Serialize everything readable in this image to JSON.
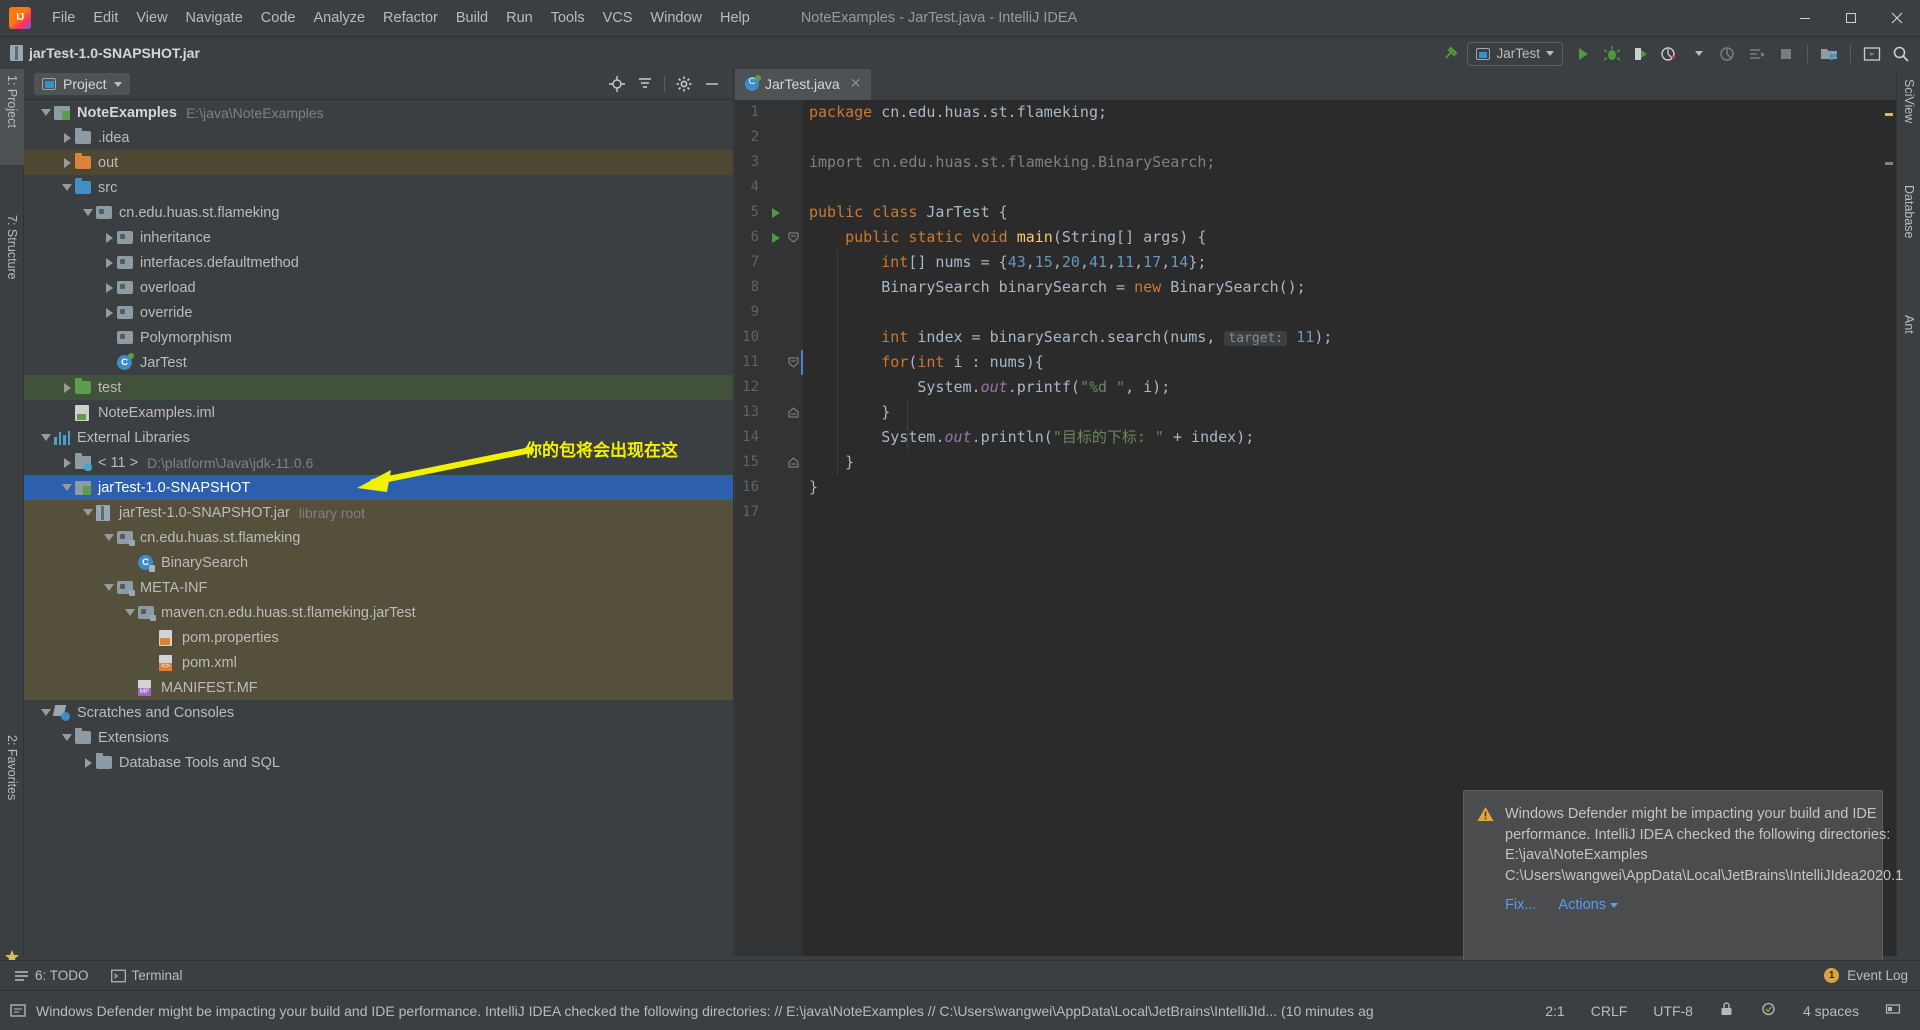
{
  "window": {
    "title": "NoteExamples - JarTest.java - IntelliJ IDEA",
    "logo_alt": "intellij-idea-logo",
    "minimize": "–",
    "maximize": "▢",
    "close": "✕"
  },
  "menu": {
    "items": [
      {
        "label": "File"
      },
      {
        "label": "Edit"
      },
      {
        "label": "View"
      },
      {
        "label": "Navigate"
      },
      {
        "label": "Code"
      },
      {
        "label": "Analyze"
      },
      {
        "label": "Refactor"
      },
      {
        "label": "Build"
      },
      {
        "label": "Run"
      },
      {
        "label": "Tools"
      },
      {
        "label": "VCS"
      },
      {
        "label": "Window"
      },
      {
        "label": "Help"
      }
    ]
  },
  "navbar": {
    "breadcrumb": "jarTest-1.0-SNAPSHOT.jar",
    "run_config": "JarTest",
    "icons": [
      "hammer-build-icon",
      "run-icon",
      "debug-icon",
      "run-coverage-icon",
      "profiler-icon",
      "attach-profiler-icon",
      "run-dashboard-icon",
      "stop-icon",
      "project-structure-icon",
      "updates-icon",
      "search-everywhere-icon"
    ]
  },
  "left_strip": {
    "tabs": [
      {
        "label": "1: Project",
        "active": true
      },
      {
        "label": "7: Structure",
        "active": false
      },
      {
        "label": "2: Favorites",
        "active": false
      }
    ]
  },
  "right_strip": {
    "tabs": [
      {
        "label": "SciView"
      },
      {
        "label": "Database"
      },
      {
        "label": "Ant"
      }
    ]
  },
  "project_panel": {
    "title": "Project",
    "actions": [
      "locate-icon",
      "collapse-all-icon",
      "settings-gear-icon",
      "hide-icon"
    ],
    "tree": [
      {
        "id": "noteexamples",
        "label": "NoteExamples",
        "sub": "E:\\java\\NoteExamples",
        "depth": 0,
        "twist": "down",
        "icon": "module-icon",
        "bold": true,
        "state": "normal"
      },
      {
        "id": "idea",
        "label": ".idea",
        "sub": "",
        "depth": 1,
        "twist": "right",
        "icon": "folder-icon",
        "bold": false,
        "state": "normal"
      },
      {
        "id": "out",
        "label": "out",
        "sub": "",
        "depth": 1,
        "twist": "right",
        "icon": "folder-orange-icon",
        "bold": false,
        "state": "out"
      },
      {
        "id": "src",
        "label": "src",
        "sub": "",
        "depth": 1,
        "twist": "down",
        "icon": "folder-blue-icon",
        "bold": false,
        "state": "normal"
      },
      {
        "id": "pkg-root",
        "label": "cn.edu.huas.st.flameking",
        "sub": "",
        "depth": 2,
        "twist": "down",
        "icon": "package-icon",
        "bold": false,
        "state": "normal"
      },
      {
        "id": "inheritance",
        "label": "inheritance",
        "sub": "",
        "depth": 3,
        "twist": "right",
        "icon": "package-icon",
        "bold": false,
        "state": "normal"
      },
      {
        "id": "interfaces",
        "label": "interfaces.defaultmethod",
        "sub": "",
        "depth": 3,
        "twist": "right",
        "icon": "package-icon",
        "bold": false,
        "state": "normal"
      },
      {
        "id": "overload",
        "label": "overload",
        "sub": "",
        "depth": 3,
        "twist": "right",
        "icon": "package-icon",
        "bold": false,
        "state": "normal"
      },
      {
        "id": "override",
        "label": "override",
        "sub": "",
        "depth": 3,
        "twist": "right",
        "icon": "package-icon",
        "bold": false,
        "state": "normal"
      },
      {
        "id": "polymorphism",
        "label": "Polymorphism",
        "sub": "",
        "depth": 3,
        "twist": "none",
        "icon": "package-icon",
        "bold": false,
        "state": "normal"
      },
      {
        "id": "jartest-class",
        "label": "JarTest",
        "sub": "",
        "depth": 3,
        "twist": "none",
        "icon": "java-class-runnable-icon",
        "bold": false,
        "state": "normal"
      },
      {
        "id": "test",
        "label": "test",
        "sub": "",
        "depth": 1,
        "twist": "right",
        "icon": "folder-green-icon",
        "bold": false,
        "state": "test"
      },
      {
        "id": "iml",
        "label": "NoteExamples.iml",
        "sub": "",
        "depth": 1,
        "twist": "none",
        "icon": "iml-file-icon",
        "bold": false,
        "state": "normal"
      },
      {
        "id": "extlibs",
        "label": "External Libraries",
        "sub": "",
        "depth": 0,
        "twist": "down",
        "icon": "external-libraries-icon",
        "bold": false,
        "state": "normal"
      },
      {
        "id": "jdk",
        "label": "< 11 >",
        "sub": "D:\\platform\\Java\\jdk-11.0.6",
        "depth": 1,
        "twist": "right",
        "icon": "jdk-icon",
        "bold": false,
        "state": "normal"
      },
      {
        "id": "jartest-lib",
        "label": "jarTest-1.0-SNAPSHOT",
        "sub": "",
        "depth": 1,
        "twist": "down",
        "icon": "library-icon",
        "bold": false,
        "state": "selected"
      },
      {
        "id": "jartest-jar",
        "label": "jarTest-1.0-SNAPSHOT.jar",
        "sub": "library root",
        "depth": 2,
        "twist": "down",
        "icon": "jar-icon",
        "bold": false,
        "state": "lib"
      },
      {
        "id": "jar-pkg",
        "label": "cn.edu.huas.st.flameking",
        "sub": "",
        "depth": 3,
        "twist": "down",
        "icon": "jar-package-icon",
        "bold": false,
        "state": "lib"
      },
      {
        "id": "binarysearch",
        "label": "BinarySearch",
        "sub": "",
        "depth": 4,
        "twist": "none",
        "icon": "java-class-locked-icon",
        "bold": false,
        "state": "lib"
      },
      {
        "id": "metainf",
        "label": "META-INF",
        "sub": "",
        "depth": 3,
        "twist": "down",
        "icon": "jar-package-icon",
        "bold": false,
        "state": "lib"
      },
      {
        "id": "maven-dir",
        "label": "maven.cn.edu.huas.st.flameking.jarTest",
        "sub": "",
        "depth": 4,
        "twist": "down",
        "icon": "jar-package-icon",
        "bold": false,
        "state": "lib"
      },
      {
        "id": "pom-properties",
        "label": "pom.properties",
        "sub": "",
        "depth": 5,
        "twist": "none",
        "icon": "properties-file-icon",
        "bold": false,
        "state": "lib"
      },
      {
        "id": "pom-xml",
        "label": "pom.xml",
        "sub": "",
        "depth": 5,
        "twist": "none",
        "icon": "xml-file-icon",
        "bold": false,
        "state": "lib"
      },
      {
        "id": "manifest",
        "label": "MANIFEST.MF",
        "sub": "",
        "depth": 4,
        "twist": "none",
        "icon": "manifest-file-icon",
        "bold": false,
        "state": "lib"
      },
      {
        "id": "scratches",
        "label": "Scratches and Consoles",
        "sub": "",
        "depth": 0,
        "twist": "down",
        "icon": "scratches-icon",
        "bold": false,
        "state": "normal"
      },
      {
        "id": "extensions",
        "label": "Extensions",
        "sub": "",
        "depth": 1,
        "twist": "down",
        "icon": "folder-icon",
        "bold": false,
        "state": "normal"
      },
      {
        "id": "dbtools",
        "label": "Database Tools and SQL",
        "sub": "",
        "depth": 2,
        "twist": "right",
        "icon": "folder-icon",
        "bold": false,
        "state": "normal"
      }
    ]
  },
  "annotation": {
    "text": "你的包将会出现在这",
    "color": "#f2f200"
  },
  "editor": {
    "tab": {
      "label": "JarTest.java",
      "close": "✕"
    },
    "lines": [
      {
        "n": 1,
        "run": false,
        "fold": "",
        "tokens": [
          [
            "kw",
            "package"
          ],
          [
            "plain",
            " cn.edu.huas.st.flameking;"
          ]
        ]
      },
      {
        "n": 2,
        "run": false,
        "fold": "",
        "tokens": []
      },
      {
        "n": 3,
        "run": false,
        "fold": "",
        "tokens": [
          [
            "gry",
            "import cn.edu.huas.st.flameking.BinarySearch;"
          ]
        ]
      },
      {
        "n": 4,
        "run": false,
        "fold": "",
        "tokens": []
      },
      {
        "n": 5,
        "run": true,
        "fold": "",
        "tokens": [
          [
            "kw",
            "public class "
          ],
          [
            "plain",
            "JarTest {"
          ]
        ]
      },
      {
        "n": 6,
        "run": true,
        "fold": "minus",
        "tokens": [
          [
            "plain",
            "    "
          ],
          [
            "kw",
            "public static void "
          ],
          [
            "fn",
            "main"
          ],
          [
            "plain",
            "(String[] args) {"
          ]
        ]
      },
      {
        "n": 7,
        "run": false,
        "fold": "",
        "tokens": [
          [
            "plain",
            "        "
          ],
          [
            "kw",
            "int"
          ],
          [
            "plain",
            "[] nums = {"
          ],
          [
            "num",
            "43"
          ],
          [
            "plain",
            ","
          ],
          [
            "num",
            "15"
          ],
          [
            "plain",
            ","
          ],
          [
            "num",
            "20"
          ],
          [
            "plain",
            ","
          ],
          [
            "num",
            "41"
          ],
          [
            "plain",
            ","
          ],
          [
            "num",
            "11"
          ],
          [
            "plain",
            ","
          ],
          [
            "num",
            "17"
          ],
          [
            "plain",
            ","
          ],
          [
            "num",
            "14"
          ],
          [
            "plain",
            "};"
          ]
        ]
      },
      {
        "n": 8,
        "run": false,
        "fold": "",
        "tokens": [
          [
            "plain",
            "        BinarySearch binarySearch = "
          ],
          [
            "kw",
            "new "
          ],
          [
            "plain",
            "BinarySearch();"
          ]
        ]
      },
      {
        "n": 9,
        "run": false,
        "fold": "",
        "tokens": []
      },
      {
        "n": 10,
        "run": false,
        "fold": "",
        "tokens": [
          [
            "plain",
            "        "
          ],
          [
            "kw",
            "int "
          ],
          [
            "plain",
            "index = binarySearch.search(nums, "
          ],
          [
            "hint",
            "target:"
          ],
          [
            "plain",
            " "
          ],
          [
            "num",
            "11"
          ],
          [
            "plain",
            ");"
          ]
        ]
      },
      {
        "n": 11,
        "run": false,
        "fold": "minus",
        "tokens": [
          [
            "plain",
            "        "
          ],
          [
            "kw",
            "for"
          ],
          [
            "plain",
            "("
          ],
          [
            "kw",
            "int "
          ],
          [
            "plain",
            "i : nums){"
          ]
        ]
      },
      {
        "n": 12,
        "run": false,
        "fold": "",
        "tokens": [
          [
            "plain",
            "            System."
          ],
          [
            "fld",
            "out"
          ],
          [
            "plain",
            ".printf("
          ],
          [
            "str",
            "\"%d \""
          ],
          [
            "plain",
            ", i);"
          ]
        ]
      },
      {
        "n": 13,
        "run": false,
        "fold": "plus",
        "tokens": [
          [
            "plain",
            "        }"
          ]
        ]
      },
      {
        "n": 14,
        "run": false,
        "fold": "",
        "tokens": [
          [
            "plain",
            "        System."
          ],
          [
            "fld",
            "out"
          ],
          [
            "plain",
            ".println("
          ],
          [
            "str",
            "\"目标的下标: \""
          ],
          [
            "plain",
            " + index);"
          ]
        ]
      },
      {
        "n": 15,
        "run": false,
        "fold": "plus",
        "tokens": [
          [
            "plain",
            "    }"
          ]
        ]
      },
      {
        "n": 16,
        "run": false,
        "fold": "",
        "tokens": [
          [
            "plain",
            "}"
          ]
        ]
      },
      {
        "n": 17,
        "run": false,
        "fold": "",
        "tokens": []
      }
    ]
  },
  "notification": {
    "icon": "warning-icon",
    "message": "Windows Defender might be impacting your build and IDE performance. IntelliJ IDEA checked the following directories: E:\\java\\NoteExamples C:\\Users\\wangwei\\AppData\\Local\\JetBrains\\IntelliJIdea2020.1",
    "fix_label": "Fix...",
    "actions_label": "Actions"
  },
  "bottom_bar": {
    "items": [
      {
        "label": "6: TODO",
        "icon": "todo-icon"
      },
      {
        "label": "Terminal",
        "icon": "terminal-icon"
      }
    ],
    "event_log": {
      "label": "Event Log",
      "count": "1"
    }
  },
  "status_bar": {
    "message": "Windows Defender might be impacting your build and IDE performance. IntelliJ IDEA checked the following directories: // E:\\java\\NoteExamples // C:\\Users\\wangwei\\AppData\\Local\\JetBrains\\IntelliJId... (10 minutes ag",
    "caret": "2:1",
    "line_separator": "CRLF",
    "encoding": "UTF-8",
    "indent": "4 spaces",
    "lock_icon": "read-only-lock-icon",
    "inspection_icon": "inspections-icon",
    "memory_icon": "memory-indicator"
  }
}
